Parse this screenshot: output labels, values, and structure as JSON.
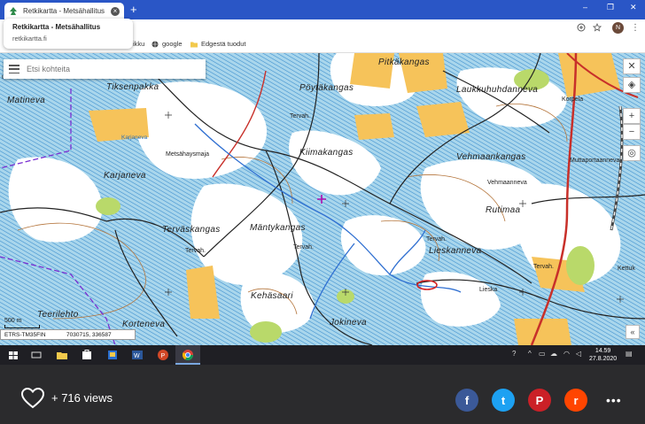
{
  "browser": {
    "tab_title": "Retkikartta - Metsähallitus",
    "tab_close": "×",
    "new_tab": "+",
    "window_min": "–",
    "window_restore": "❐",
    "window_close": "✕",
    "profile_initial": "N",
    "hovercard_title": "Retkikartta - Metsähallitus",
    "hovercard_url": "retkikartta.fi",
    "bookmarks": [
      {
        "label": "ikku"
      },
      {
        "label": "google"
      },
      {
        "label": "Edgestä tuodut"
      }
    ],
    "accent": "#2a56c6"
  },
  "map": {
    "search_placeholder": "Etsi kohteita",
    "places_big": [
      "Matineva",
      "Tiksenpakka",
      "Pöytäkangas",
      "Pitkäkangas",
      "Laukkuhuhdanneva",
      "Kiimakangas",
      "Vehmaankangas",
      "Karjaneva",
      "Terväskangas",
      "Mäntykangas",
      "Rutimaa",
      "Lieskanneva",
      "Kehäsaari",
      "Jokineva",
      "Korteneva",
      "Teerilehto"
    ],
    "places_small": [
      "urveluae",
      "Tervah.",
      "Metsähaysmaja",
      "Karjaneva",
      "Vehmaanneva",
      "Muttaportaanneva",
      "Korpela",
      "Tervah.",
      "Tervah.",
      "Tervah.",
      "Tervah.",
      "Lieska",
      "Kettuk"
    ],
    "scale_label": "500 m",
    "crs": "ETRS-TM35FIN",
    "coordinates": "7030715, 336587",
    "zoom_in": "+",
    "zoom_out": "−",
    "collapse": "«",
    "colors": {
      "swamp": "#a9d6ec",
      "forest": "#ffffff",
      "field": "#f6c35a",
      "green": "#b9d96a",
      "road": "#c8302a"
    }
  },
  "taskbar": {
    "clock_time": "14.59",
    "clock_date": "27.8.2020"
  },
  "footer": {
    "views_text": "+ 716 views",
    "share": [
      {
        "network": "facebook",
        "glyph": "f",
        "color": "#3b5998"
      },
      {
        "network": "twitter",
        "glyph": "t",
        "color": "#1da1f2"
      },
      {
        "network": "pinterest",
        "glyph": "P",
        "color": "#cb2027"
      },
      {
        "network": "reddit",
        "glyph": "r",
        "color": "#ff4500"
      }
    ],
    "more": "•••"
  }
}
